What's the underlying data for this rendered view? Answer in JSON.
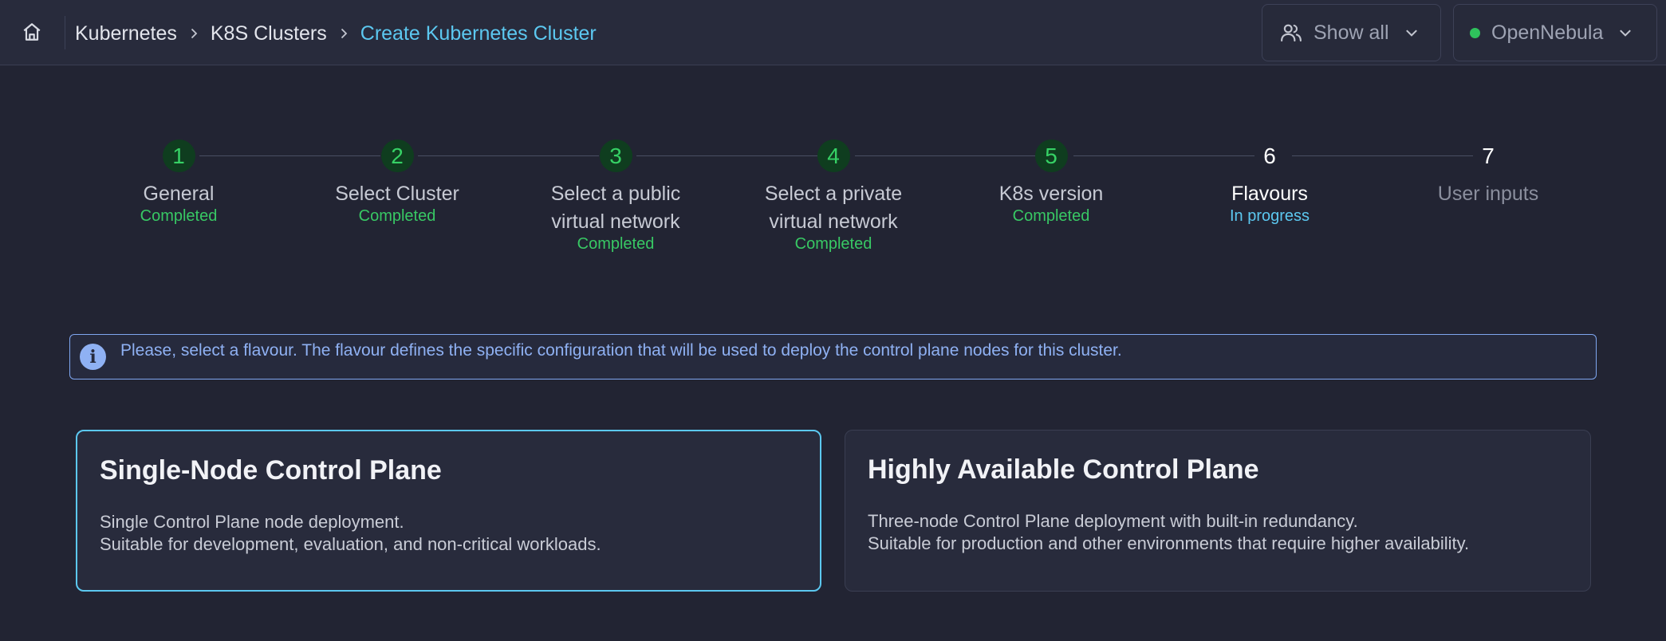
{
  "header": {
    "breadcrumb": [
      "Kubernetes",
      "K8S Clusters",
      "Create Kubernetes Cluster"
    ],
    "show_all_label": "Show all",
    "zone_label": "OpenNebula",
    "zone_status_color": "#2fc25c",
    "icons": {
      "home": "home-icon",
      "users": "users-icon",
      "chevron": "chevron-down-icon",
      "separator": "chevron-right-icon"
    }
  },
  "stepper": {
    "steps": [
      {
        "number": "1",
        "label_lines": [
          "General"
        ],
        "status": "Completed",
        "state": "completed"
      },
      {
        "number": "2",
        "label_lines": [
          "Select Cluster"
        ],
        "status": "Completed",
        "state": "completed"
      },
      {
        "number": "3",
        "label_lines": [
          "Select a public",
          "virtual network"
        ],
        "status": "Completed",
        "state": "completed"
      },
      {
        "number": "4",
        "label_lines": [
          "Select a private",
          "virtual network"
        ],
        "status": "Completed",
        "state": "completed"
      },
      {
        "number": "5",
        "label_lines": [
          "K8s version"
        ],
        "status": "Completed",
        "state": "completed"
      },
      {
        "number": "6",
        "label_lines": [
          "Flavours"
        ],
        "status": "In progress",
        "state": "in-progress"
      },
      {
        "number": "7",
        "label_lines": [
          "User inputs"
        ],
        "status": "",
        "state": "pending"
      }
    ]
  },
  "info": {
    "icon": "info-icon",
    "text": "Please, select a flavour. The flavour defines the specific configuration that will be used to deploy the control plane nodes for this cluster."
  },
  "flavours": [
    {
      "title": "Single-Node Control Plane",
      "lines": [
        "Single Control Plane node deployment.",
        "Suitable for development, evaluation, and non-critical workloads."
      ],
      "selected": true
    },
    {
      "title": "Highly Available Control Plane",
      "lines": [
        "Three-node Control Plane deployment with built-in redundancy.",
        "Suitable for production and other environments that require higher availability."
      ],
      "selected": false
    }
  ],
  "colors": {
    "accent": "#5cc8f0",
    "completed": "#38c864",
    "info": "#8fb1f3",
    "background": "#222433"
  }
}
